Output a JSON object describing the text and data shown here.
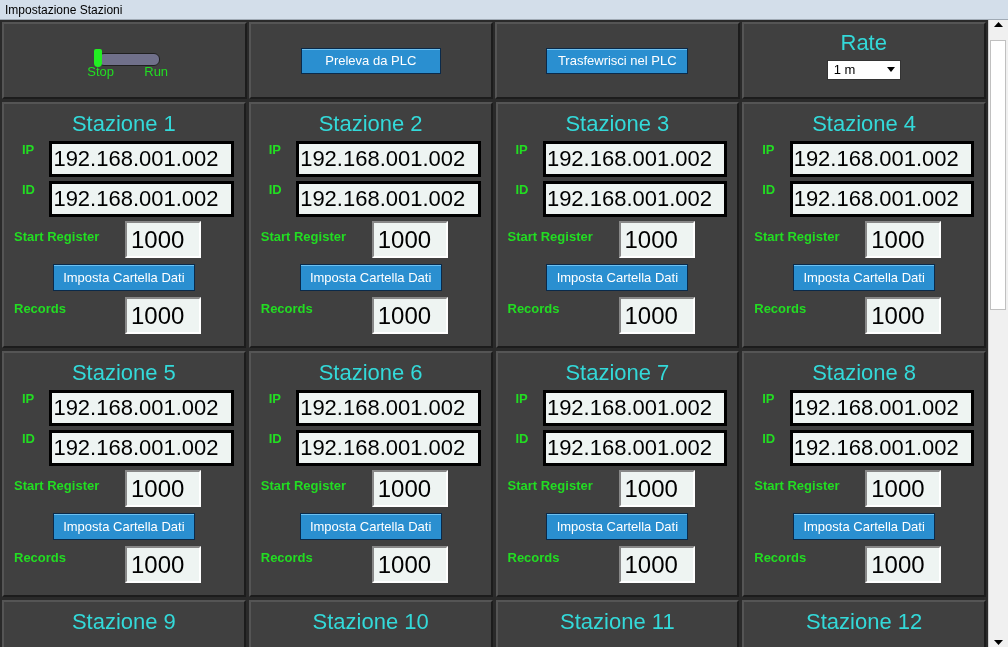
{
  "window": {
    "title": "Impostazione Stazioni"
  },
  "toolbar": {
    "switch": {
      "on": false,
      "off_label": "Stop",
      "on_label": "Run"
    },
    "fetch_button": "Preleva da PLC",
    "send_button": "Trasfewrisci nel PLC",
    "rate": {
      "label": "Rate",
      "value": "1 m"
    }
  },
  "stations": [
    {
      "title": "Stazione 1",
      "ip_label": "IP",
      "ip": "192.168.001.002",
      "id_label": "ID",
      "id": "192.168.001.002",
      "start_label": "Start Register",
      "start": "1000",
      "folder_button": "Imposta Cartella Dati",
      "records_label": "Records",
      "records": "1000"
    },
    {
      "title": "Stazione 2",
      "ip_label": "IP",
      "ip": "192.168.001.002",
      "id_label": "ID",
      "id": "192.168.001.002",
      "start_label": "Start Register",
      "start": "1000",
      "folder_button": "Imposta Cartella Dati",
      "records_label": "Records",
      "records": "1000"
    },
    {
      "title": "Stazione 3",
      "ip_label": "IP",
      "ip": "192.168.001.002",
      "id_label": "ID",
      "id": "192.168.001.002",
      "start_label": "Start Register",
      "start": "1000",
      "folder_button": "Imposta Cartella Dati",
      "records_label": "Records",
      "records": "1000"
    },
    {
      "title": "Stazione 4",
      "ip_label": "IP",
      "ip": "192.168.001.002",
      "id_label": "ID",
      "id": "192.168.001.002",
      "start_label": "Start Register",
      "start": "1000",
      "folder_button": "Imposta Cartella Dati",
      "records_label": "Records",
      "records": "1000"
    },
    {
      "title": "Stazione 5",
      "ip_label": "IP",
      "ip": "192.168.001.002",
      "id_label": "ID",
      "id": "192.168.001.002",
      "start_label": "Start Register",
      "start": "1000",
      "folder_button": "Imposta Cartella Dati",
      "records_label": "Records",
      "records": "1000"
    },
    {
      "title": "Stazione 6",
      "ip_label": "IP",
      "ip": "192.168.001.002",
      "id_label": "ID",
      "id": "192.168.001.002",
      "start_label": "Start Register",
      "start": "1000",
      "folder_button": "Imposta Cartella Dati",
      "records_label": "Records",
      "records": "1000"
    },
    {
      "title": "Stazione 7",
      "ip_label": "IP",
      "ip": "192.168.001.002",
      "id_label": "ID",
      "id": "192.168.001.002",
      "start_label": "Start Register",
      "start": "1000",
      "folder_button": "Imposta Cartella Dati",
      "records_label": "Records",
      "records": "1000"
    },
    {
      "title": "Stazione 8",
      "ip_label": "IP",
      "ip": "192.168.001.002",
      "id_label": "ID",
      "id": "192.168.001.002",
      "start_label": "Start Register",
      "start": "1000",
      "folder_button": "Imposta Cartella Dati",
      "records_label": "Records",
      "records": "1000"
    },
    {
      "title": "Stazione 9"
    },
    {
      "title": "Stazione 10"
    },
    {
      "title": "Stazione 11"
    },
    {
      "title": "Stazione 12"
    }
  ]
}
